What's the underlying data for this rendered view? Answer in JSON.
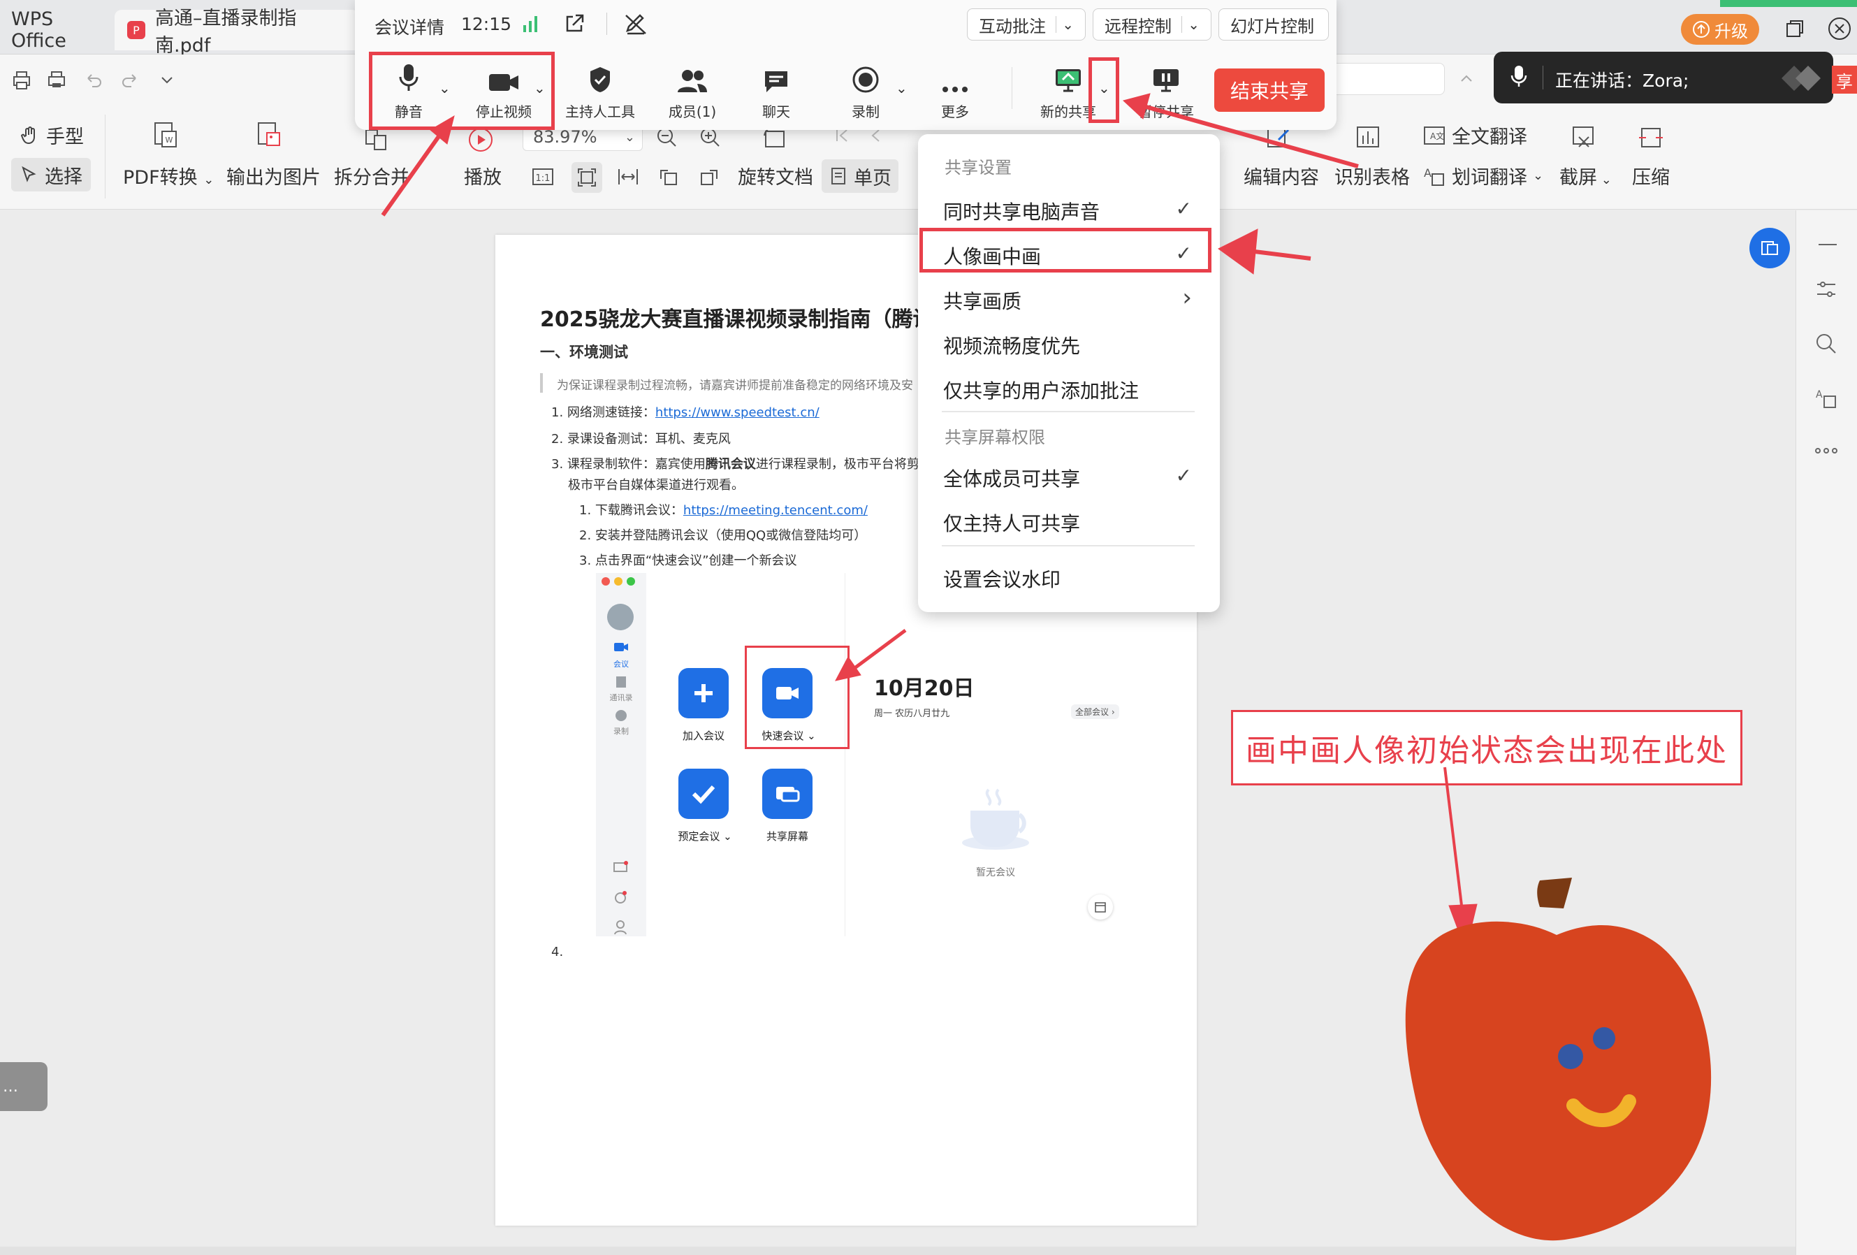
{
  "tabs": [
    {
      "label": "WPS Office"
    },
    {
      "label": "高通–直播录制指南.pdf"
    }
  ],
  "upgrade_label": "升级",
  "meeting": {
    "details_label": "会议详情",
    "time": "12:15",
    "pills": {
      "annotate": "互动批注",
      "remote": "远程控制",
      "slides": "幻灯片控制"
    },
    "buttons": {
      "mute": "静音",
      "stop_video": "停止视频",
      "host_tools": "主持人工具",
      "members": "成员(1)",
      "chat": "聊天",
      "record": "录制",
      "more": "更多",
      "new_share": "新的共享",
      "pause_share": "暂停共享",
      "end_share": "结束共享"
    },
    "speaking_prefix": "正在讲话：",
    "speaker": "Zora;"
  },
  "dropdown": {
    "section1": "共享设置",
    "items1": [
      {
        "label": "同时共享电脑声音",
        "checked": true
      },
      {
        "label": "人像画中画",
        "checked": true
      },
      {
        "label": "共享画质",
        "submenu": true
      },
      {
        "label": "视频流畅度优先"
      },
      {
        "label": "仅共享的用户添加批注"
      }
    ],
    "section2": "共享屏幕权限",
    "items2": [
      {
        "label": "全体成员可共享",
        "checked": true
      },
      {
        "label": "仅主持人可共享"
      }
    ],
    "item3": "设置会议水印",
    "check_glyph": "✓",
    "arrow_glyph": "›"
  },
  "ribbon": {
    "hand": "手型",
    "select": "选择",
    "pdf_convert": "PDF转换",
    "export_image": "输出为图片",
    "split_merge": "拆分合并",
    "play": "播放",
    "zoom": "83.97%",
    "rotate": "旋转文档",
    "single_page": "单页",
    "edit_content": "编辑内容",
    "recognize_table": "识别表格",
    "full_translate": "全文翻译",
    "word_translate": "划词翻译",
    "screenshot": "截屏",
    "compress": "压缩"
  },
  "document": {
    "title": "2025骁龙大赛直播课视频录制指南（腾讯",
    "section1": "一、环境测试",
    "quote": "为保证课程录制过程流畅，请嘉宾讲师提前准备稳定的网络环境及安",
    "item1_prefix": "1.  网络测速链接：",
    "item1_link": "https://www.speedtest.cn/",
    "item2": "2.  录课设备测试：耳机、麦克风",
    "item3_a": "3.  课程录制软件：嘉宾使用",
    "item3_bold": "腾讯会议",
    "item3_b": "进行课程录制，极市平台将剪辑",
    "item3_line2": "极市平台自媒体渠道进行观看。",
    "sub1_prefix": "1.  下载腾讯会议：",
    "sub1_link": "https://meeting.tencent.com/",
    "sub2": "2.  安装并登陆腾讯会议（使用QQ或微信登陆均可）",
    "sub3": "3.  点击界面“快速会议”创建一个新会议",
    "item4": "4.",
    "embedded": {
      "nav": [
        "会议",
        "通讯录",
        "录制"
      ],
      "join": "加入会议",
      "quick": "快速会议",
      "schedule": "预定会议",
      "share_screen": "共享屏幕",
      "date": "10月20日",
      "lunar": "周一 农历八月廿九",
      "all_meetings": "全部会议 ›",
      "no_meeting": "暂无会议"
    }
  },
  "annotation_note": "画中画人像初始状态会出现在此处",
  "colors": {
    "accent_red": "#e8404b",
    "blue": "#1f6fe5",
    "apple": "#d7441f"
  }
}
